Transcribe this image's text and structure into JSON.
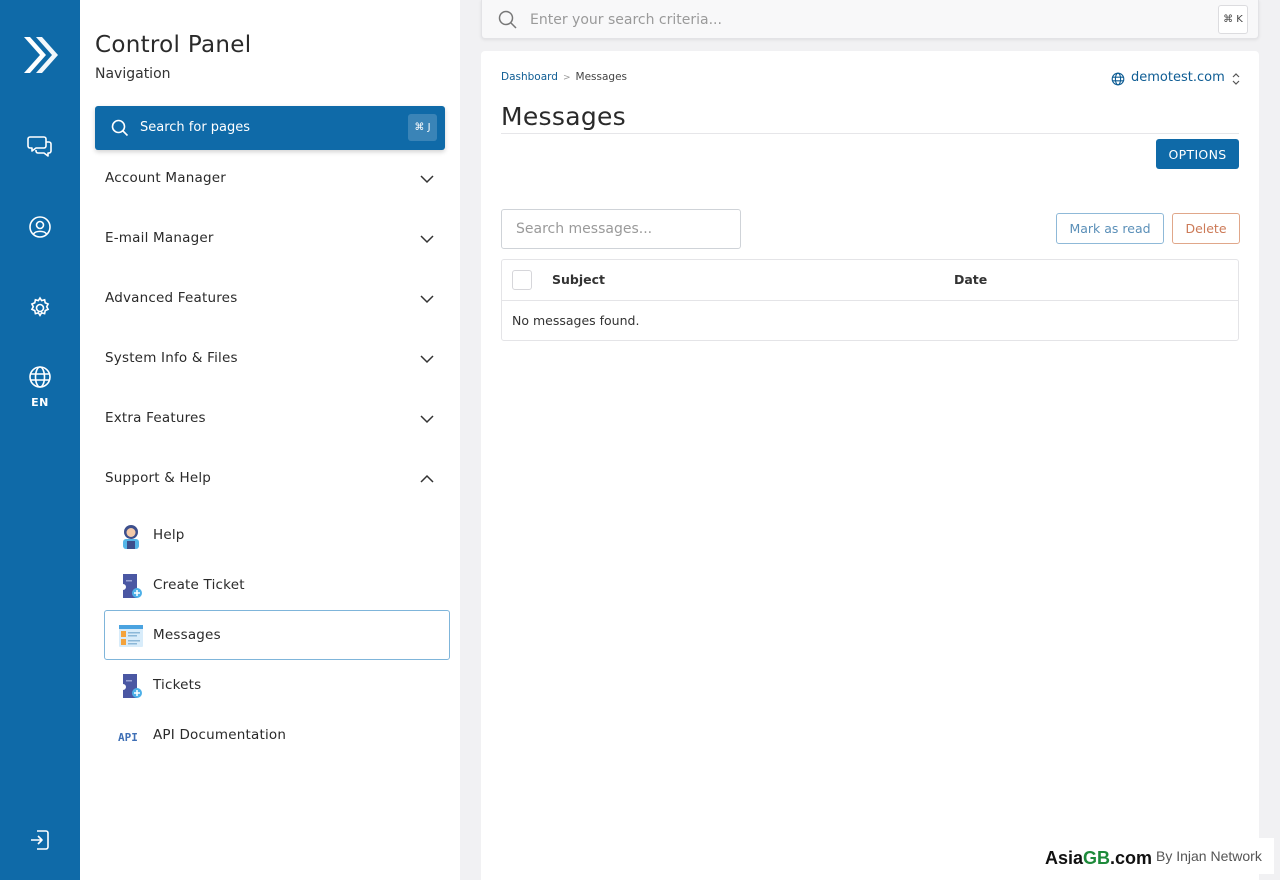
{
  "rail": {
    "lang": "EN",
    "icons": [
      "logo-icon",
      "chat-icon",
      "user-circle-icon",
      "gear-icon",
      "globe-icon",
      "logout-icon"
    ]
  },
  "nav": {
    "title": "Control Panel",
    "subtitle": "Navigation",
    "search_label": "Search for pages",
    "search_shortcut": "⌘ J",
    "sections": [
      {
        "label": "Account Manager",
        "expanded": false
      },
      {
        "label": "E-mail Manager",
        "expanded": false
      },
      {
        "label": "Advanced Features",
        "expanded": false
      },
      {
        "label": "System Info & Files",
        "expanded": false
      },
      {
        "label": "Extra Features",
        "expanded": false
      },
      {
        "label": "Support & Help",
        "expanded": true
      }
    ],
    "support_items": [
      {
        "label": "Help",
        "icon": "help-agent-icon"
      },
      {
        "label": "Create Ticket",
        "icon": "create-ticket-icon"
      },
      {
        "label": "Messages",
        "icon": "messages-icon",
        "active": true
      },
      {
        "label": "Tickets",
        "icon": "tickets-icon"
      },
      {
        "label": "API Documentation",
        "icon": "api-icon"
      }
    ]
  },
  "topbar": {
    "search_placeholder": "Enter your search criteria...",
    "shortcut": "⌘ K"
  },
  "main": {
    "breadcrumb": [
      "Dashboard",
      "Messages"
    ],
    "domain": "demotest.com",
    "title": "Messages",
    "options_label": "OPTIONS",
    "search_placeholder": "Search messages...",
    "mark_read_label": "Mark as read",
    "delete_label": "Delete",
    "table": {
      "columns": [
        "Subject",
        "Date"
      ],
      "empty_text": "No messages found."
    }
  },
  "watermark": {
    "brand_a": "Asia",
    "brand_b": "GB",
    "brand_c": ".com",
    "by": "By Injan Network"
  },
  "colors": {
    "primary": "#0f6aa8",
    "link": "#0f5d94",
    "danger": "#cc7a57"
  }
}
